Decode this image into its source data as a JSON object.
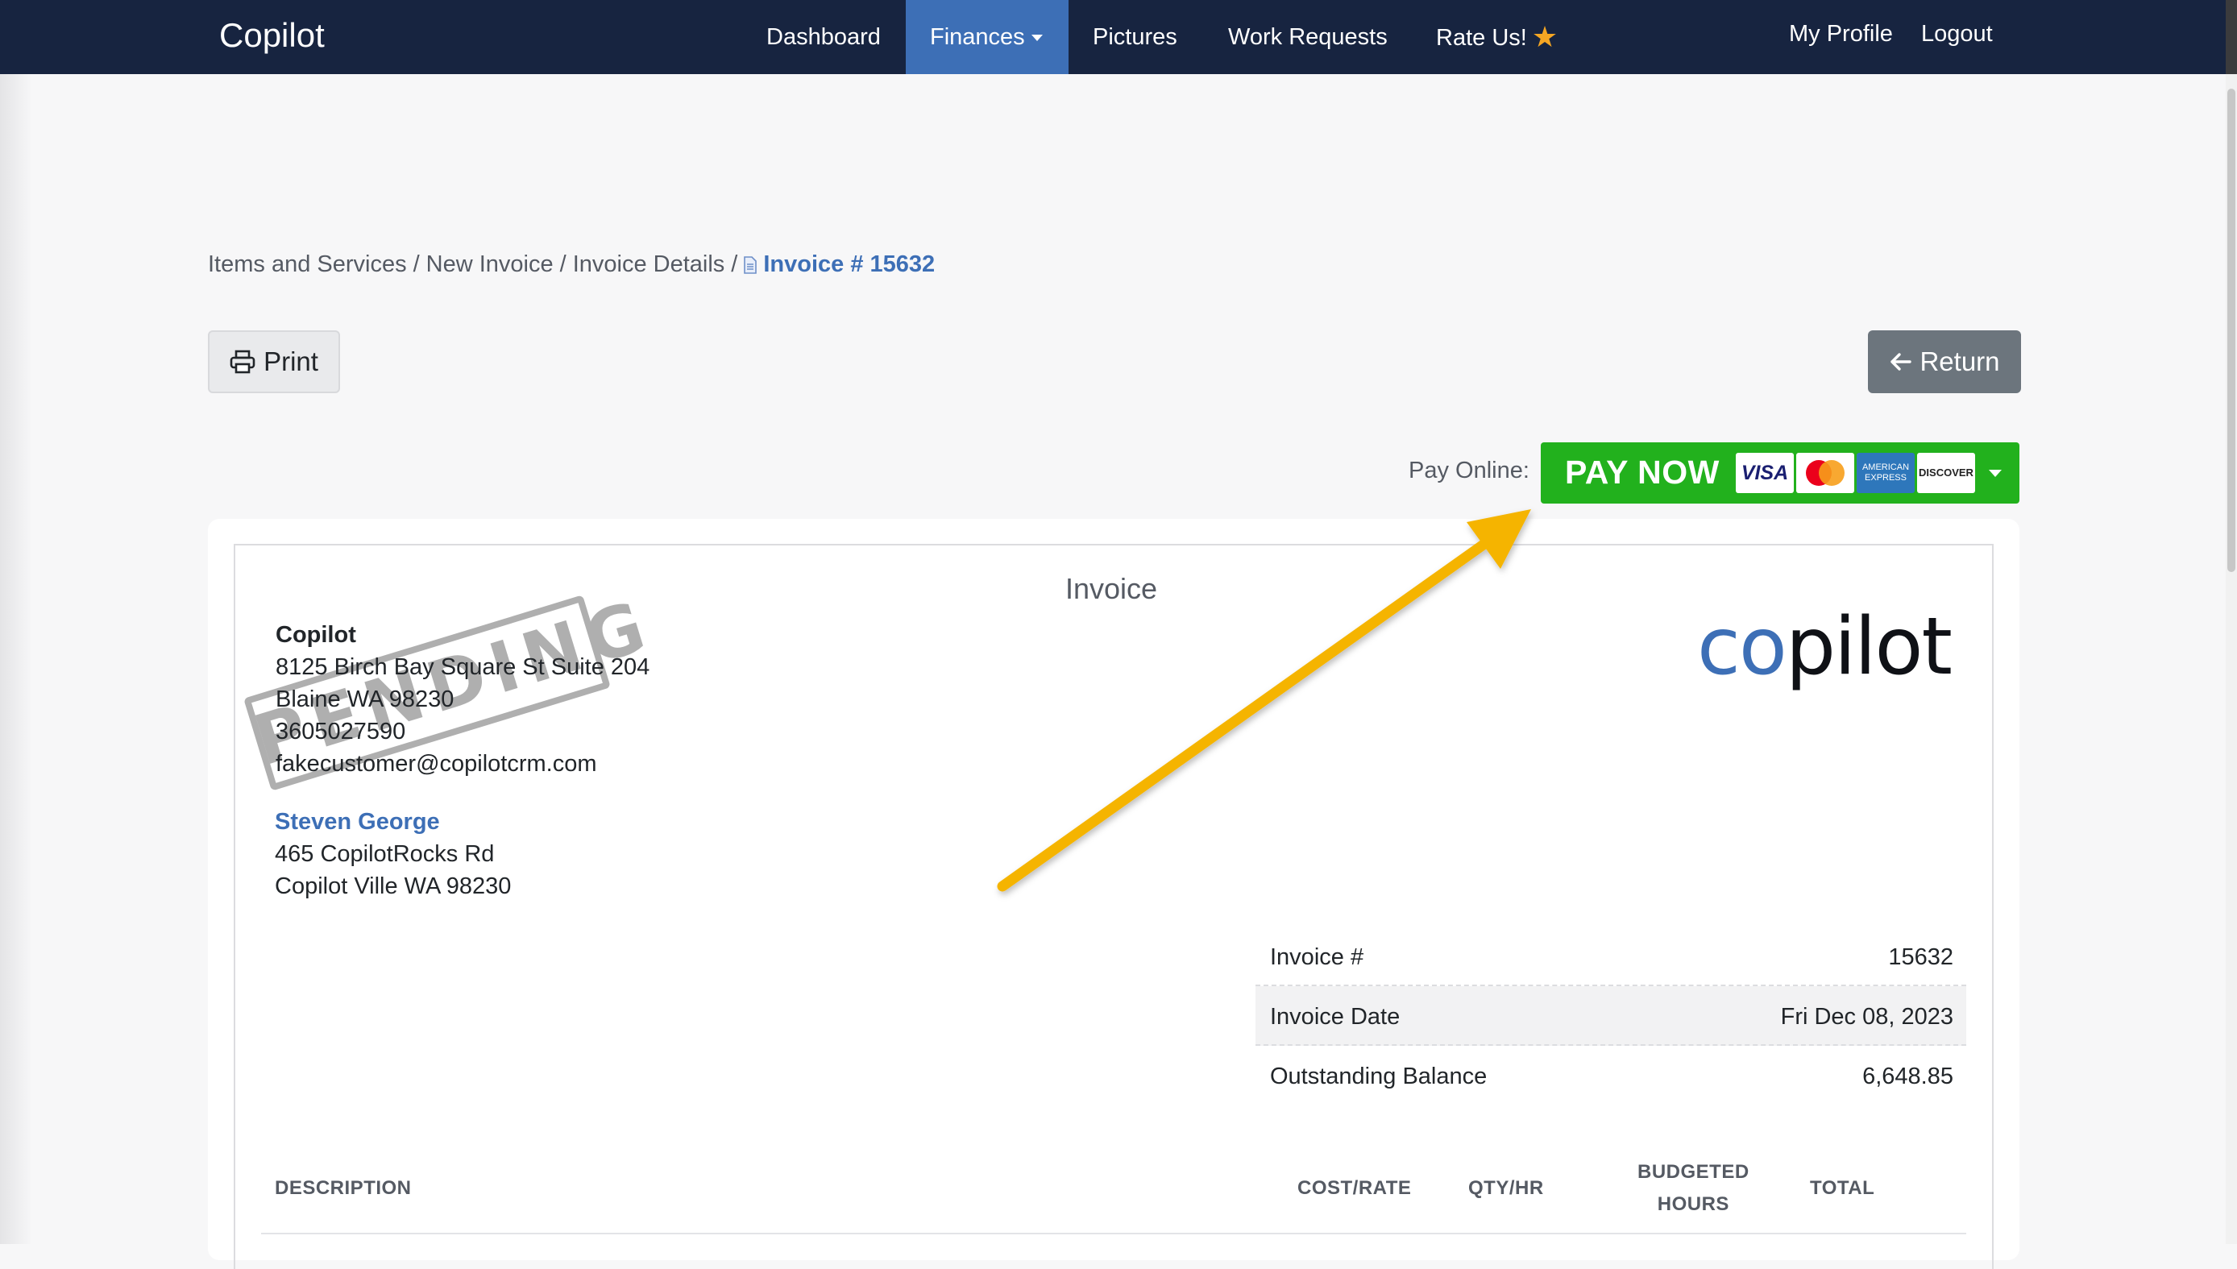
{
  "navbar": {
    "brand": "Copilot",
    "items": [
      {
        "label": "Dashboard"
      },
      {
        "label": "Finances",
        "active": true,
        "has_caret": true
      },
      {
        "label": "Pictures"
      },
      {
        "label": "Work Requests"
      },
      {
        "label": "Rate Us!",
        "icon": "star-icon"
      }
    ],
    "right": [
      {
        "label": "My Profile"
      },
      {
        "label": "Logout"
      }
    ],
    "colors": {
      "background": "#172440",
      "active": "#3d6fb6",
      "star": "#f5a623"
    }
  },
  "breadcrumb": {
    "items": [
      "Items and Services",
      "New Invoice",
      "Invoice Details"
    ],
    "separator": "/",
    "current": "Invoice # 15632",
    "current_icon": "document-icon"
  },
  "toolbar": {
    "print_label": "Print",
    "print_icon": "printer-icon",
    "return_label": "Return",
    "return_icon": "arrow-left-icon"
  },
  "pay_online": {
    "label": "Pay Online:",
    "button_label": "PAY NOW",
    "cards": [
      "VISA",
      "MasterCard",
      "AMERICAN EXPRESS",
      "DISCOVER"
    ],
    "color": "#22b11d"
  },
  "invoice": {
    "title": "Invoice",
    "from": {
      "name": "Copilot",
      "address1": "8125 Birch Bay Square St Suite 204",
      "address2": "Blaine WA 98230",
      "phone": "3605027590",
      "email": "fakecustomer@copilotcrm.com"
    },
    "stamp": "PENDING",
    "to": {
      "name": "Steven George",
      "address1": "465 CopilotRocks Rd",
      "address2": "Copilot Ville WA 98230"
    },
    "logo": {
      "part1": "co",
      "part2": "pilot"
    },
    "details": [
      {
        "key": "Invoice #",
        "value": "15632"
      },
      {
        "key": "Invoice Date",
        "value": "Fri Dec 08, 2023"
      },
      {
        "key": "Outstanding Balance",
        "value": "6,648.85"
      }
    ],
    "columns": {
      "description": "DESCRIPTION",
      "cost_rate": "COST/RATE",
      "qty_hr": "QTY/HR",
      "budgeted_line1": "BUDGETED",
      "budgeted_line2": "HOURS",
      "total": "TOTAL"
    }
  },
  "annotation": {
    "arrow_color": "#f5b400"
  }
}
